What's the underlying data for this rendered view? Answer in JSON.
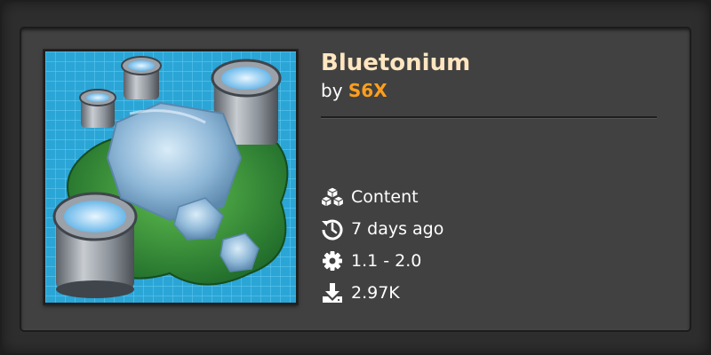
{
  "mod": {
    "title": "Bluetonium",
    "by_prefix": "by",
    "author": "S6X"
  },
  "meta": [
    {
      "icon": "cubes-icon",
      "text": "Content"
    },
    {
      "icon": "history-icon",
      "text": "7 days ago"
    },
    {
      "icon": "gear-icon",
      "text": "1.1 - 2.0"
    },
    {
      "icon": "download-icon",
      "text": "2.97K"
    }
  ],
  "colors": {
    "title": "#ffe6c0",
    "author": "#ff9f1c",
    "card": "#414141",
    "background": "#2f2e2e"
  }
}
